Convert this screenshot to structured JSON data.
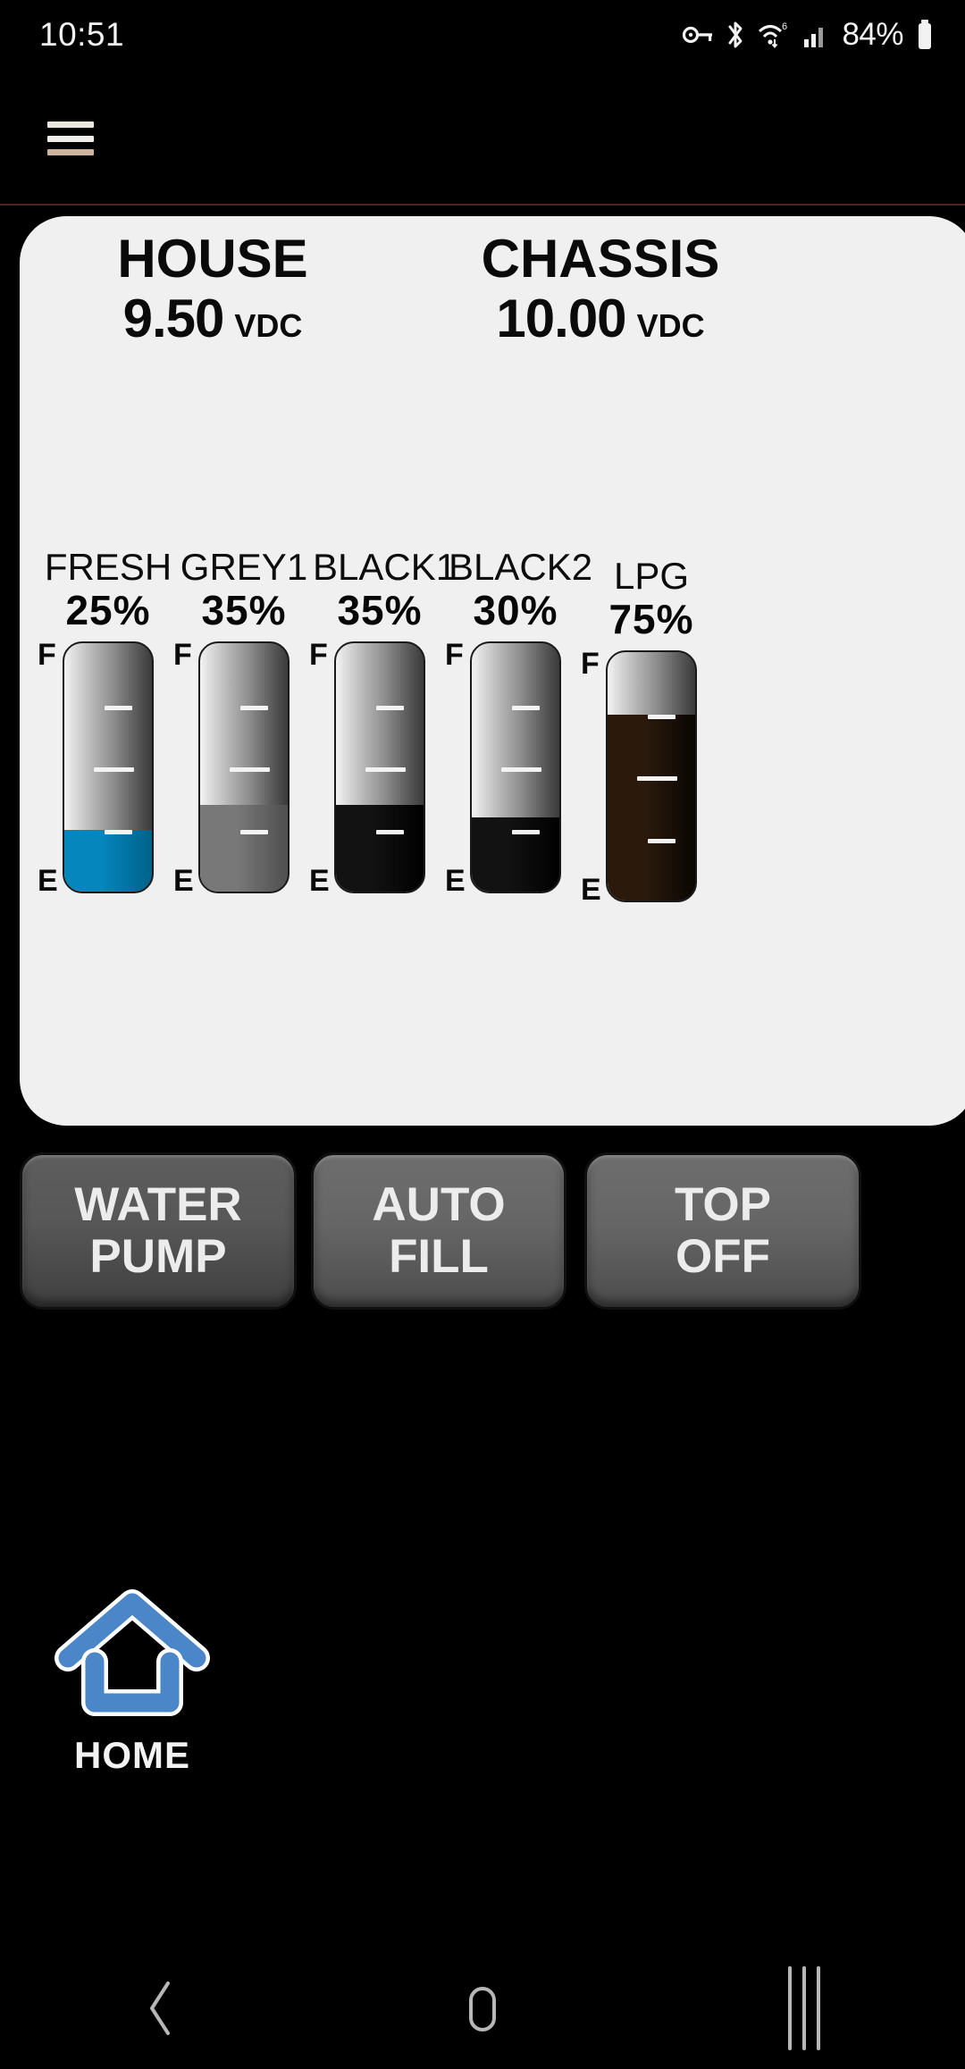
{
  "status_bar": {
    "time": "10:51",
    "battery_percent": "84%",
    "icons": [
      "vpn-key-icon",
      "bluetooth-icon",
      "wifi-6-icon",
      "cellular-signal-icon",
      "battery-icon"
    ]
  },
  "app_bar": {
    "menu_icon": "hamburger-menu-icon"
  },
  "voltages": [
    {
      "name": "HOUSE",
      "value": "9.50",
      "unit": "VDC"
    },
    {
      "name": "CHASSIS",
      "value": "10.00",
      "unit": "VDC"
    }
  ],
  "scale": {
    "full": "F",
    "empty": "E"
  },
  "tanks": [
    {
      "name": "FRESH",
      "percent_label": "25%",
      "percent": 25,
      "fill_color": "#0586bd",
      "fill_color_dark": "#00628a",
      "bold_pct": false
    },
    {
      "name": "GREY1",
      "percent_label": "35%",
      "percent": 35,
      "fill_color": "#787878",
      "fill_color_dark": "#4f4f4f",
      "bold_pct": false
    },
    {
      "name": "BLACK1",
      "percent_label": "35%",
      "percent": 35,
      "fill_color": "#121212",
      "fill_color_dark": "#000000",
      "bold_pct": false
    },
    {
      "name": "BLACK2",
      "percent_label": "30%",
      "percent": 30,
      "fill_color": "#121212",
      "fill_color_dark": "#000000",
      "bold_pct": false
    },
    {
      "name": "LPG",
      "percent_label": "75%",
      "percent": 75,
      "fill_color": "#2b1a0c",
      "fill_color_dark": "#0a0603",
      "bold_pct": true
    }
  ],
  "tank_heaters": [
    {
      "for_tank": "GREY1",
      "icon": "tank-heater-icon",
      "active": false
    },
    {
      "for_tank": "BLACK2",
      "icon": "tank-heater-icon",
      "active": false
    }
  ],
  "buttons": [
    {
      "line1": "WATER",
      "line2": "PUMP",
      "style": "dark"
    },
    {
      "line1": "AUTO",
      "line2": "FILL",
      "style": "light"
    },
    {
      "line1": "TOP",
      "line2": "OFF",
      "style": "light"
    }
  ],
  "home": {
    "label": "HOME",
    "icon": "home-house-icon",
    "color": "#4a86c8"
  },
  "nav_bar": {
    "back": "back-chevron-icon",
    "home": "home-circle-icon",
    "recents": "recents-icon"
  },
  "colors": {
    "panel_bg": "#f0f0f1",
    "screen_bg": "#000000",
    "accent_blue": "#0586bd",
    "home_blue": "#4a86c8",
    "divider": "#4a2a16"
  }
}
